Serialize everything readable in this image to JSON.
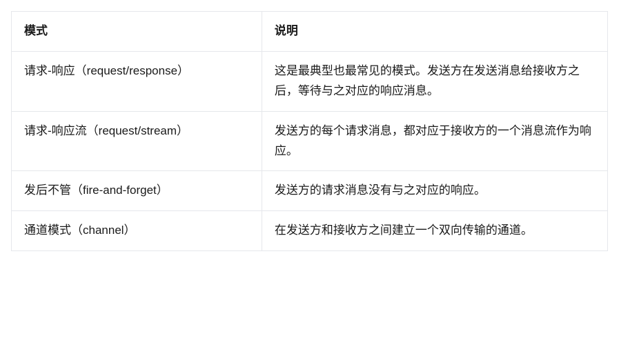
{
  "table": {
    "headers": {
      "mode": "模式",
      "description": "说明"
    },
    "rows": [
      {
        "mode": "请求-响应（request/response）",
        "description": "这是最典型也最常见的模式。发送方在发送消息给接收方之后，等待与之对应的响应消息。"
      },
      {
        "mode": "请求-响应流（request/stream）",
        "description": "发送方的每个请求消息，都对应于接收方的一个消息流作为响应。"
      },
      {
        "mode": "发后不管（fire-and-forget）",
        "description": "发送方的请求消息没有与之对应的响应。"
      },
      {
        "mode": "通道模式（channel）",
        "description": "在发送方和接收方之间建立一个双向传输的通道。"
      }
    ]
  }
}
